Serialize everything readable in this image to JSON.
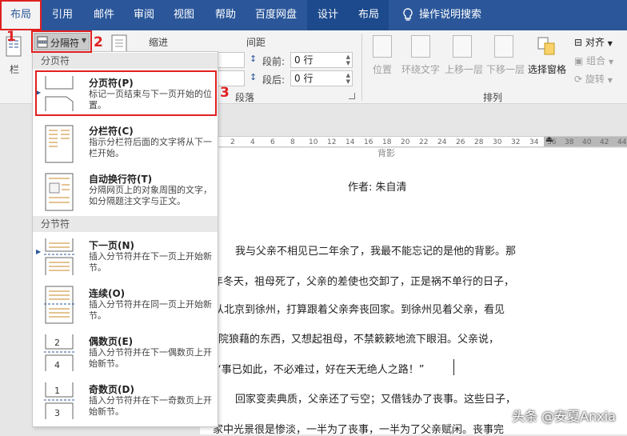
{
  "tabs": [
    "布局",
    "引用",
    "邮件",
    "审阅",
    "视图",
    "帮助",
    "百度网盘",
    "设计",
    "布局"
  ],
  "tell_me": "操作说明搜索",
  "ribbon": {
    "breaks_button": "分隔符",
    "col_label": "栏",
    "indent_label": "缩进",
    "spacing_label": "间距",
    "before_label": "段前:",
    "before_value": "0 行",
    "after_label": "段后:",
    "after_value": "0 行",
    "paragraph_group": "段落",
    "arrange": {
      "position": "位置",
      "wrap_text": "环绕文字",
      "bring_forward": "上移一层",
      "send_backward": "下移一层",
      "selection_pane": "选择窗格",
      "align": "对齐",
      "group": "组合",
      "rotate": "旋转",
      "group_label": "排列"
    }
  },
  "menu": {
    "section_page": "分页符",
    "section_section": "分节符",
    "items": [
      {
        "title": "分页符(P)",
        "desc": "标记一页结束与下一页开始的位置。"
      },
      {
        "title": "分栏符(C)",
        "desc": "指示分栏符后面的文字将从下一栏开始。"
      },
      {
        "title": "自动换行符(T)",
        "desc": "分隔网页上的对象周围的文字，如分隔题注文字与正文。"
      },
      {
        "title": "下一页(N)",
        "desc": "插入分节符并在下一页上开始新节。"
      },
      {
        "title": "连续(O)",
        "desc": "插入分节符并在同一页上开始新节。"
      },
      {
        "title": "偶数页(E)",
        "desc": "插入分节符并在下一偶数页上开始新节。"
      },
      {
        "title": "奇数页(D)",
        "desc": "插入分节符并在下一奇数页上开始新节。"
      }
    ]
  },
  "ruler_numbers": [
    "2",
    "4",
    "6",
    "8",
    "10",
    "12",
    "14",
    "16",
    "18",
    "20",
    "22",
    "24",
    "26",
    "28",
    "30",
    "32",
    "34",
    "36",
    "38",
    "40",
    "42",
    "44",
    "46",
    "48"
  ],
  "document": {
    "title_partial": "背影",
    "author": "作者: 朱自清",
    "lines": [
      "我与父亲不相见已二年余了，我最不能忘记的是他的背影。那",
      "年冬天，祖母死了，父亲的差使也交卸了，正是祸不单行的日子，",
      "我从北京到徐州，打算跟着父亲奔丧回家。到徐州见着父亲，看见",
      "满院狼藉的东西，又想起祖母，不禁簌簌地流下眼泪。父亲说，",
      "“事已如此，不必难过，好在天无绝人之路！”",
      "回家变卖典质，父亲还了亏空；又借钱办了丧事。这些日子，",
      "家中光景很是惨淡，一半为了丧事，一半为了父亲赋闲。丧事完"
    ]
  },
  "annotations": [
    "1",
    "2",
    "3"
  ],
  "watermark": "头条 @安夏Anxia"
}
